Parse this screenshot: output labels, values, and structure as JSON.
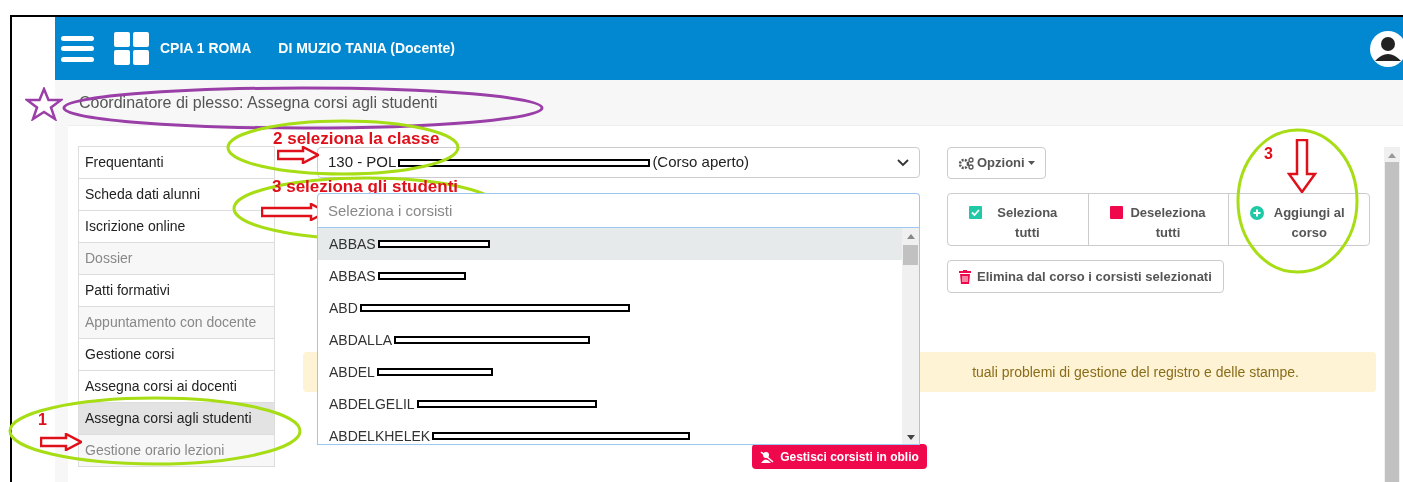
{
  "header": {
    "school": "CPIA 1 ROMA",
    "user": "DI MUZIO TANIA (Docente)"
  },
  "page_title": "Coordinatore di plesso: Assegna corsi agli studenti",
  "sidebar": {
    "items": [
      {
        "label": "Frequentanti",
        "selected": false,
        "disabled": false
      },
      {
        "label": "Scheda dati alunni",
        "selected": false,
        "disabled": false
      },
      {
        "label": "Iscrizione online",
        "selected": false,
        "disabled": false
      },
      {
        "label": "Dossier",
        "selected": false,
        "disabled": true
      },
      {
        "label": "Patti formativi",
        "selected": false,
        "disabled": false
      },
      {
        "label": "Appuntamento con docente",
        "selected": false,
        "disabled": true
      },
      {
        "label": "Gestione corsi",
        "selected": false,
        "disabled": false
      },
      {
        "label": "Assegna corsi ai docenti",
        "selected": false,
        "disabled": false
      },
      {
        "label": "Assegna corsi agli studenti",
        "selected": true,
        "disabled": false
      },
      {
        "label": "Gestione orario lezioni",
        "selected": false,
        "disabled": true
      }
    ]
  },
  "class_select": {
    "value_start": "130 - POL",
    "value_end": "(Corso aperto)"
  },
  "students_field": {
    "placeholder": "Seleziona i corsisti"
  },
  "students": [
    {
      "name": "ABBAS",
      "highlighted": true
    },
    {
      "name": "ABBAS",
      "highlighted": false
    },
    {
      "name": "ABD",
      "highlighted": false
    },
    {
      "name": "ABDALLA",
      "highlighted": false
    },
    {
      "name": "ABDEL",
      "highlighted": false
    },
    {
      "name": "ABDELGELIL",
      "highlighted": false
    },
    {
      "name": "ABDELKHELEK",
      "highlighted": false
    }
  ],
  "options_button": "Opzioni",
  "button_group": [
    {
      "kind": "select_all",
      "label": "Seleziona tutti"
    },
    {
      "kind": "deselect_all",
      "label": "Deseleziona tutti"
    },
    {
      "kind": "add",
      "label": "Aggiungi al corso"
    }
  ],
  "delete_button": "Elimina dal corso i corsisti selezionati",
  "alert": "tuali problemi di gestione del registro e delle stampe.",
  "oblio_button": "Gestisci corsisti in oblio",
  "annotations": [
    {
      "kind": "step",
      "text": "2 seleziona la classe"
    },
    {
      "kind": "step",
      "text": "3 seleziona gli studenti"
    },
    {
      "kind": "step",
      "text": "1"
    },
    {
      "kind": "step",
      "text": "3"
    }
  ]
}
